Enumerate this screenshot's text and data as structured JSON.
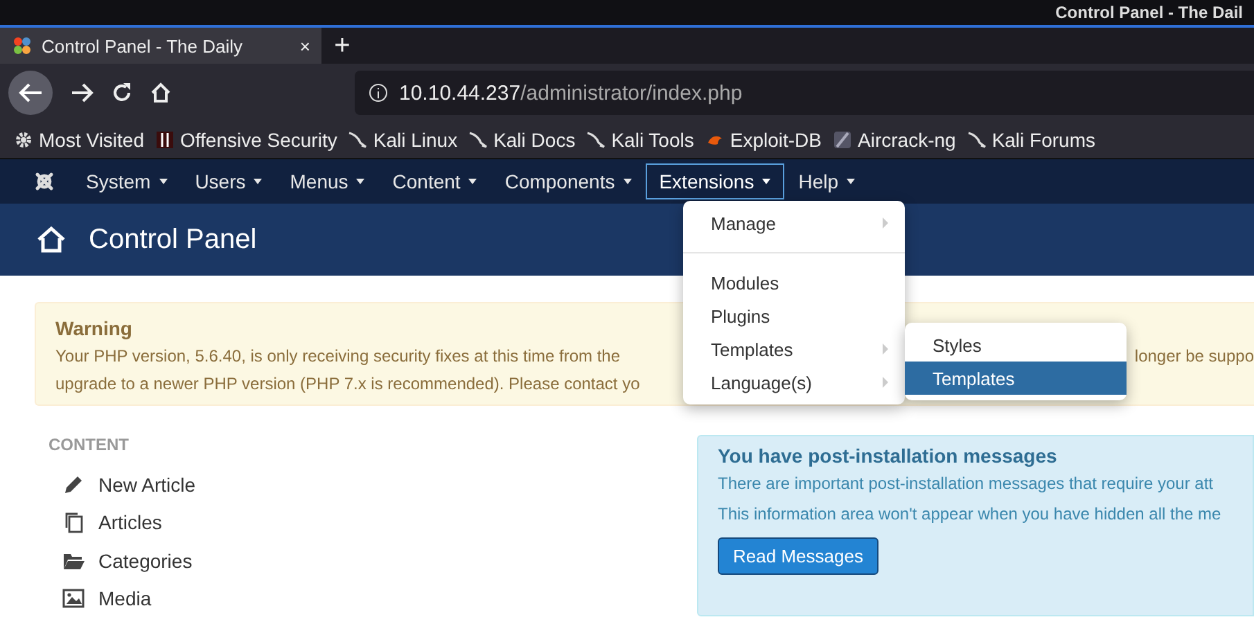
{
  "os_title": "Control Panel - The Dail",
  "browser": {
    "tab": {
      "title": "Control Panel - The Daily",
      "selected": true,
      "close": "×"
    },
    "new_tab": "+",
    "url": {
      "host": "10.10.44.237",
      "path": "/administrator/index.php"
    },
    "bookmarks": [
      {
        "label": "Most Visited",
        "kind": "gear"
      },
      {
        "label": "Offensive Security",
        "kind": "offsec"
      },
      {
        "label": "Kali Linux",
        "kind": "kali"
      },
      {
        "label": "Kali Docs",
        "kind": "kali"
      },
      {
        "label": "Kali Tools",
        "kind": "kali"
      },
      {
        "label": "Exploit-DB",
        "kind": "exploit"
      },
      {
        "label": "Aircrack-ng",
        "kind": "aircrack"
      },
      {
        "label": "Kali Forums",
        "kind": "kali"
      }
    ]
  },
  "admin_menu": [
    {
      "label": "System",
      "selected": false
    },
    {
      "label": "Users",
      "selected": false
    },
    {
      "label": "Menus",
      "selected": false
    },
    {
      "label": "Content",
      "selected": false
    },
    {
      "label": "Components",
      "selected": false
    },
    {
      "label": "Extensions",
      "selected": true
    },
    {
      "label": "Help",
      "selected": false
    }
  ],
  "dropdown": {
    "groups": [
      [
        {
          "label": "Manage",
          "submenu": true
        }
      ],
      [
        {
          "label": "Modules",
          "submenu": false
        },
        {
          "label": "Plugins",
          "submenu": false
        },
        {
          "label": "Templates",
          "submenu": true
        },
        {
          "label": "Language(s)",
          "submenu": true
        }
      ]
    ],
    "submenu": [
      {
        "label": "Styles",
        "selected": false
      },
      {
        "label": "Templates",
        "selected": true
      }
    ]
  },
  "header": {
    "title": "Control Panel"
  },
  "warning": {
    "title": "Warning",
    "line_1": "Your PHP version, 5.6.40, is only receiving security fixes at this time from the",
    "line_1_end": "longer be suppo",
    "line_2": "upgrade to a newer PHP version (PHP 7.x is recommended). Please contact yo"
  },
  "content": {
    "heading": "CONTENT",
    "items": [
      {
        "label": "New Article",
        "kind": "pencil"
      },
      {
        "label": "Articles",
        "kind": "copy"
      },
      {
        "label": "Categories",
        "kind": "folder"
      },
      {
        "label": "Media",
        "kind": "image"
      }
    ]
  },
  "messages": {
    "title": "You have post-installation messages",
    "paragraphs": [
      "There are important post-installation messages that require your att",
      "This information area won't appear when you have hidden all the me"
    ],
    "button": "Read Messages"
  }
}
